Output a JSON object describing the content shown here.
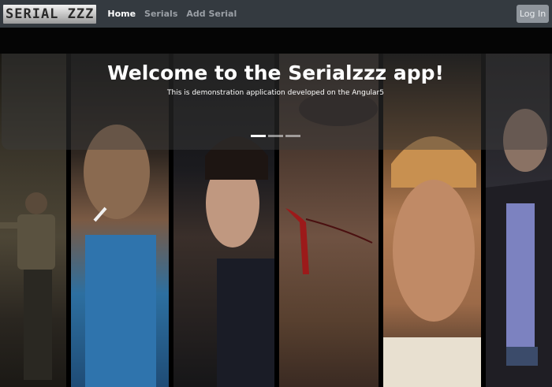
{
  "brand": {
    "logo_text": "SERIAL ZZZ"
  },
  "nav": {
    "items": [
      {
        "label": "Home",
        "active": true
      },
      {
        "label": "Serials",
        "active": false
      },
      {
        "label": "Add Serial",
        "active": false
      }
    ]
  },
  "login": {
    "label": "Log In"
  },
  "hero": {
    "title": "Welcome to the Serialzzz app!",
    "subtitle": "This is demonstration application developed on the Angular5"
  },
  "carousel": {
    "slides": 3,
    "active_index": 0
  },
  "colors": {
    "navbar": "#343a40",
    "login_button": "#8f959c"
  },
  "posters": [
    "poster-1",
    "poster-2",
    "poster-3",
    "poster-4",
    "poster-5",
    "poster-6"
  ]
}
